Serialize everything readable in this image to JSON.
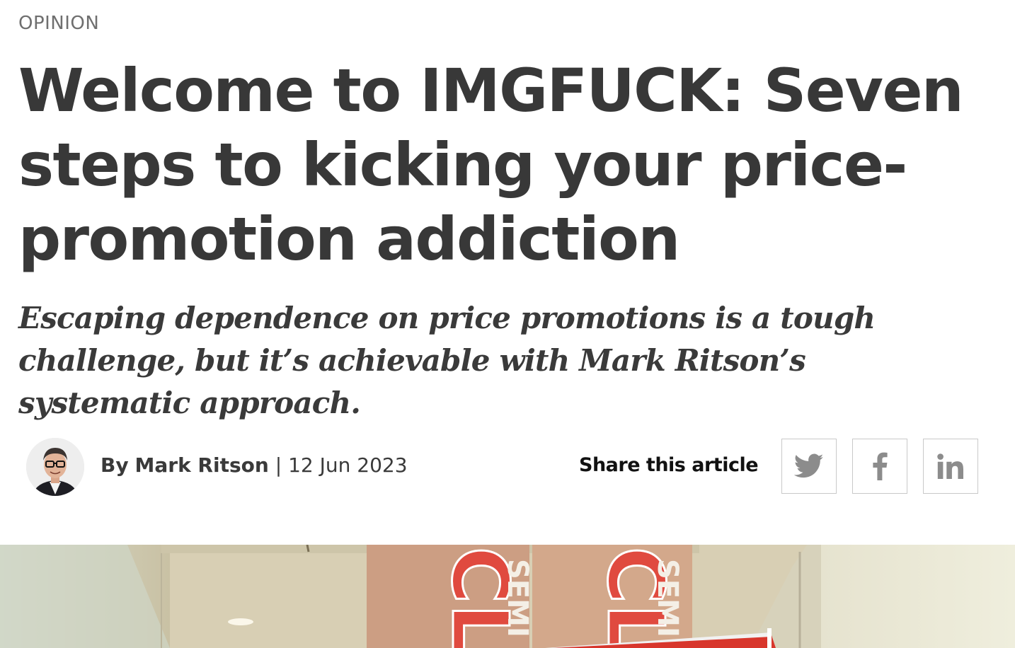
{
  "article": {
    "category": "OPINION",
    "headline": "Welcome to IMGFUCK: Seven steps to kicking your price-promotion addiction",
    "standfirst": "Escaping dependence on price promotions is a tough challenge, but it’s achievable with Mark Ritson’s systematic approach."
  },
  "byline": {
    "prefix": "By",
    "author": "Mark Ritson",
    "separator": "|",
    "date": "12 Jun 2023"
  },
  "share": {
    "label": "Share this article",
    "buttons": [
      {
        "icon": "twitter-icon"
      },
      {
        "icon": "facebook-icon"
      },
      {
        "icon": "linkedin-icon"
      }
    ]
  },
  "hero_image": {
    "sign_text": "SEMI",
    "sign_text_2": "CL"
  },
  "colors": {
    "headline": "#383838",
    "category": "#6f6f6f",
    "icon_grey": "#8c8c8c",
    "sign_red": "#e04a3f"
  }
}
